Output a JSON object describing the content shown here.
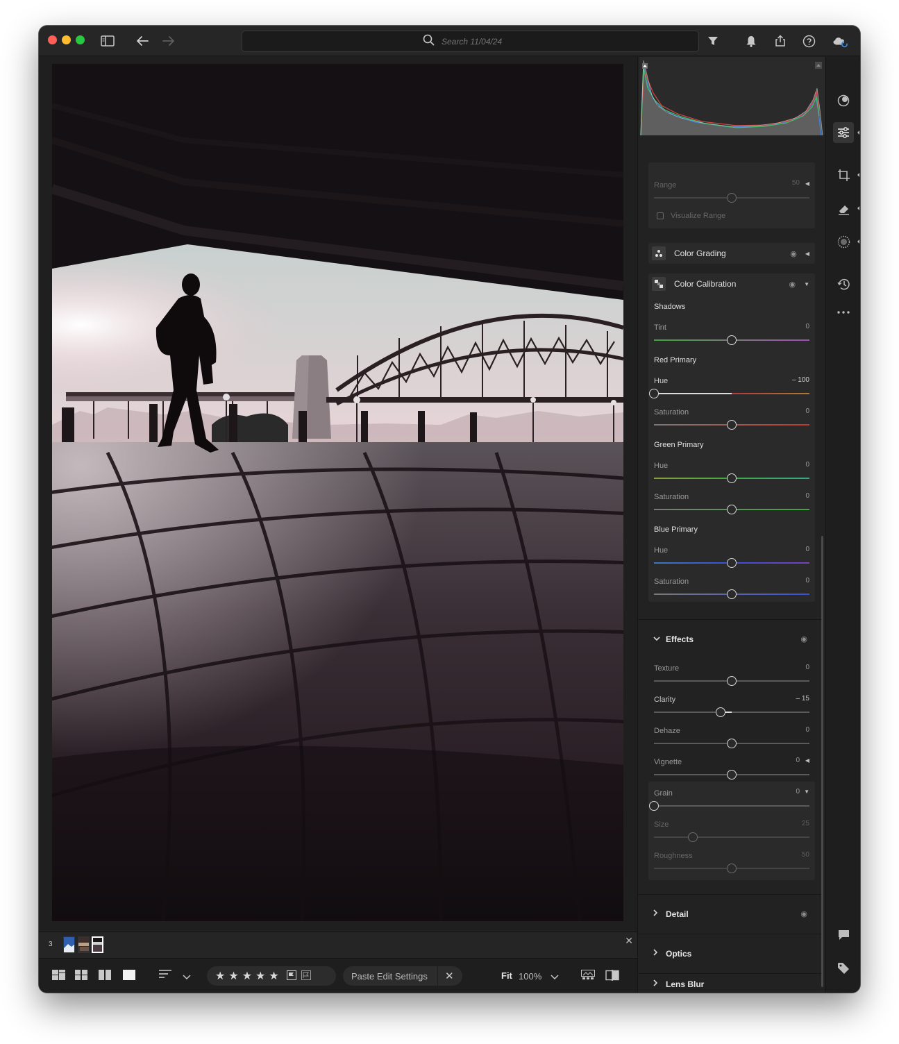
{
  "titlebar": {
    "search_placeholder": "Search 11/04/24"
  },
  "filmstrip": {
    "count": "3"
  },
  "toolbar": {
    "paste_label": "Paste Edit Settings",
    "fit_label": "Fit",
    "zoom_label": "100%",
    "stars": [
      "★",
      "★",
      "★",
      "★",
      "★"
    ]
  },
  "masking": {
    "range_label": "Range",
    "range_value": "50",
    "range_fraction": 0.5,
    "visualize_label": "Visualize Range"
  },
  "color_grading": {
    "title": "Color Grading"
  },
  "calibration": {
    "title": "Color Calibration",
    "shadows_label": "Shadows",
    "shadows_tint_label": "Tint",
    "shadows_tint_value": "0",
    "red_label": "Red Primary",
    "red_hue_label": "Hue",
    "red_hue_value": "– 100",
    "red_sat_label": "Saturation",
    "red_sat_value": "0",
    "green_label": "Green Primary",
    "green_hue_label": "Hue",
    "green_hue_value": "0",
    "green_sat_label": "Saturation",
    "green_sat_value": "0",
    "blue_label": "Blue Primary",
    "blue_hue_label": "Hue",
    "blue_hue_value": "0",
    "blue_sat_label": "Saturation",
    "blue_sat_value": "0"
  },
  "effects": {
    "title": "Effects",
    "texture_label": "Texture",
    "texture_value": "0",
    "clarity_label": "Clarity",
    "clarity_value": "– 15",
    "dehaze_label": "Dehaze",
    "dehaze_value": "0",
    "vignette_label": "Vignette",
    "vignette_value": "0",
    "grain_label": "Grain",
    "grain_value": "0",
    "size_label": "Size",
    "size_value": "25",
    "roughness_label": "Roughness",
    "roughness_value": "50"
  },
  "sections": {
    "detail": "Detail",
    "optics": "Optics",
    "lens_blur": "Lens Blur"
  },
  "colors": {
    "shadow_tint": "#a14fb2",
    "red_primary": "#c0392b",
    "green_primary": "#3fa83f",
    "blue_primary": "#3b4fd6"
  }
}
